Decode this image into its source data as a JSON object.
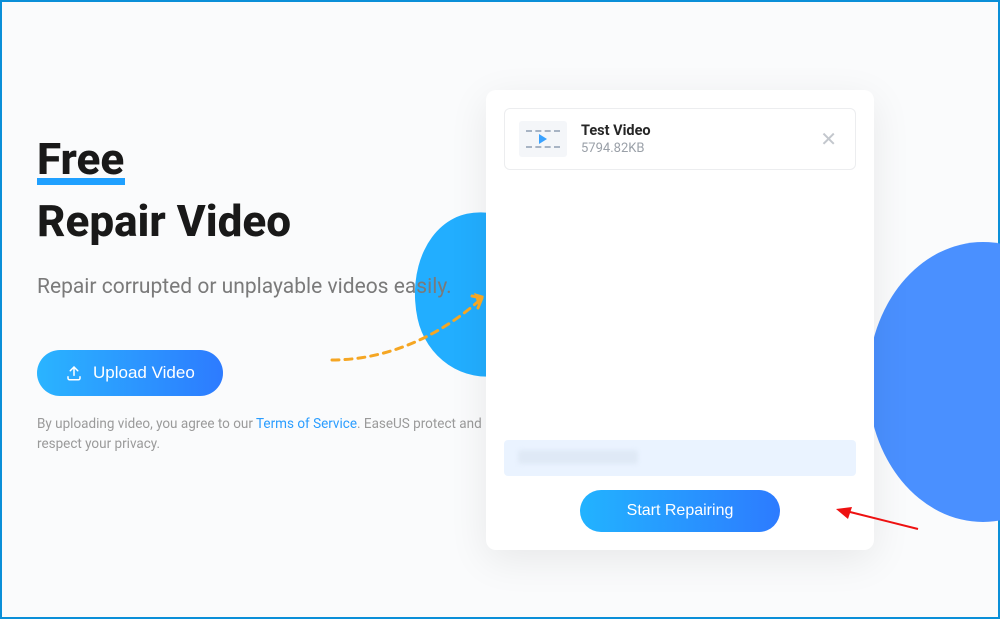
{
  "hero": {
    "title_free": "Free",
    "title_repair": "Repair Video",
    "subtitle": "Repair corrupted or unplayable videos easily.",
    "upload_label": "Upload Video",
    "agree_prefix": "By uploading video, you agree to our ",
    "tos_label": "Terms of Service",
    "agree_suffix": ". EaseUS protect and respect your privacy."
  },
  "panel": {
    "file": {
      "name": "Test Video",
      "size": "5794.82KB"
    },
    "start_label": "Start Repairing"
  }
}
